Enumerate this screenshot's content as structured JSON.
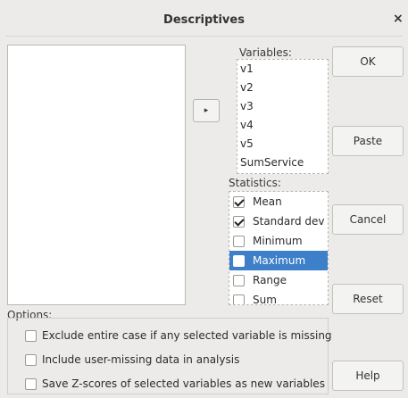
{
  "dialog": {
    "title": "Descriptives",
    "close_glyph": "×",
    "move_glyph": "▸"
  },
  "variables": {
    "label": "Variables:",
    "items": [
      "v1",
      "v2",
      "v3",
      "v4",
      "v5",
      "SumService"
    ]
  },
  "statistics": {
    "label": "Statistics:",
    "items": [
      {
        "label": "Mean",
        "checked": true,
        "selected": false
      },
      {
        "label": "Standard dev",
        "checked": true,
        "selected": false
      },
      {
        "label": "Minimum",
        "checked": false,
        "selected": false
      },
      {
        "label": "Maximum",
        "checked": false,
        "selected": true
      },
      {
        "label": "Range",
        "checked": false,
        "selected": false
      },
      {
        "label": "Sum",
        "checked": false,
        "selected": false
      }
    ]
  },
  "buttons": {
    "ok": "OK",
    "paste": "Paste",
    "cancel": "Cancel",
    "reset": "Reset",
    "help": "Help"
  },
  "options": {
    "label": "Options:",
    "items": [
      {
        "label": "Exclude entire case if any selected variable is missing",
        "checked": false
      },
      {
        "label": "Include user-missing data in analysis",
        "checked": false
      },
      {
        "label": "Save Z-scores of selected variables as new variables",
        "checked": false
      }
    ]
  },
  "colors": {
    "selection": "#3d7fc9",
    "dialog_bg": "#ecebe9"
  }
}
